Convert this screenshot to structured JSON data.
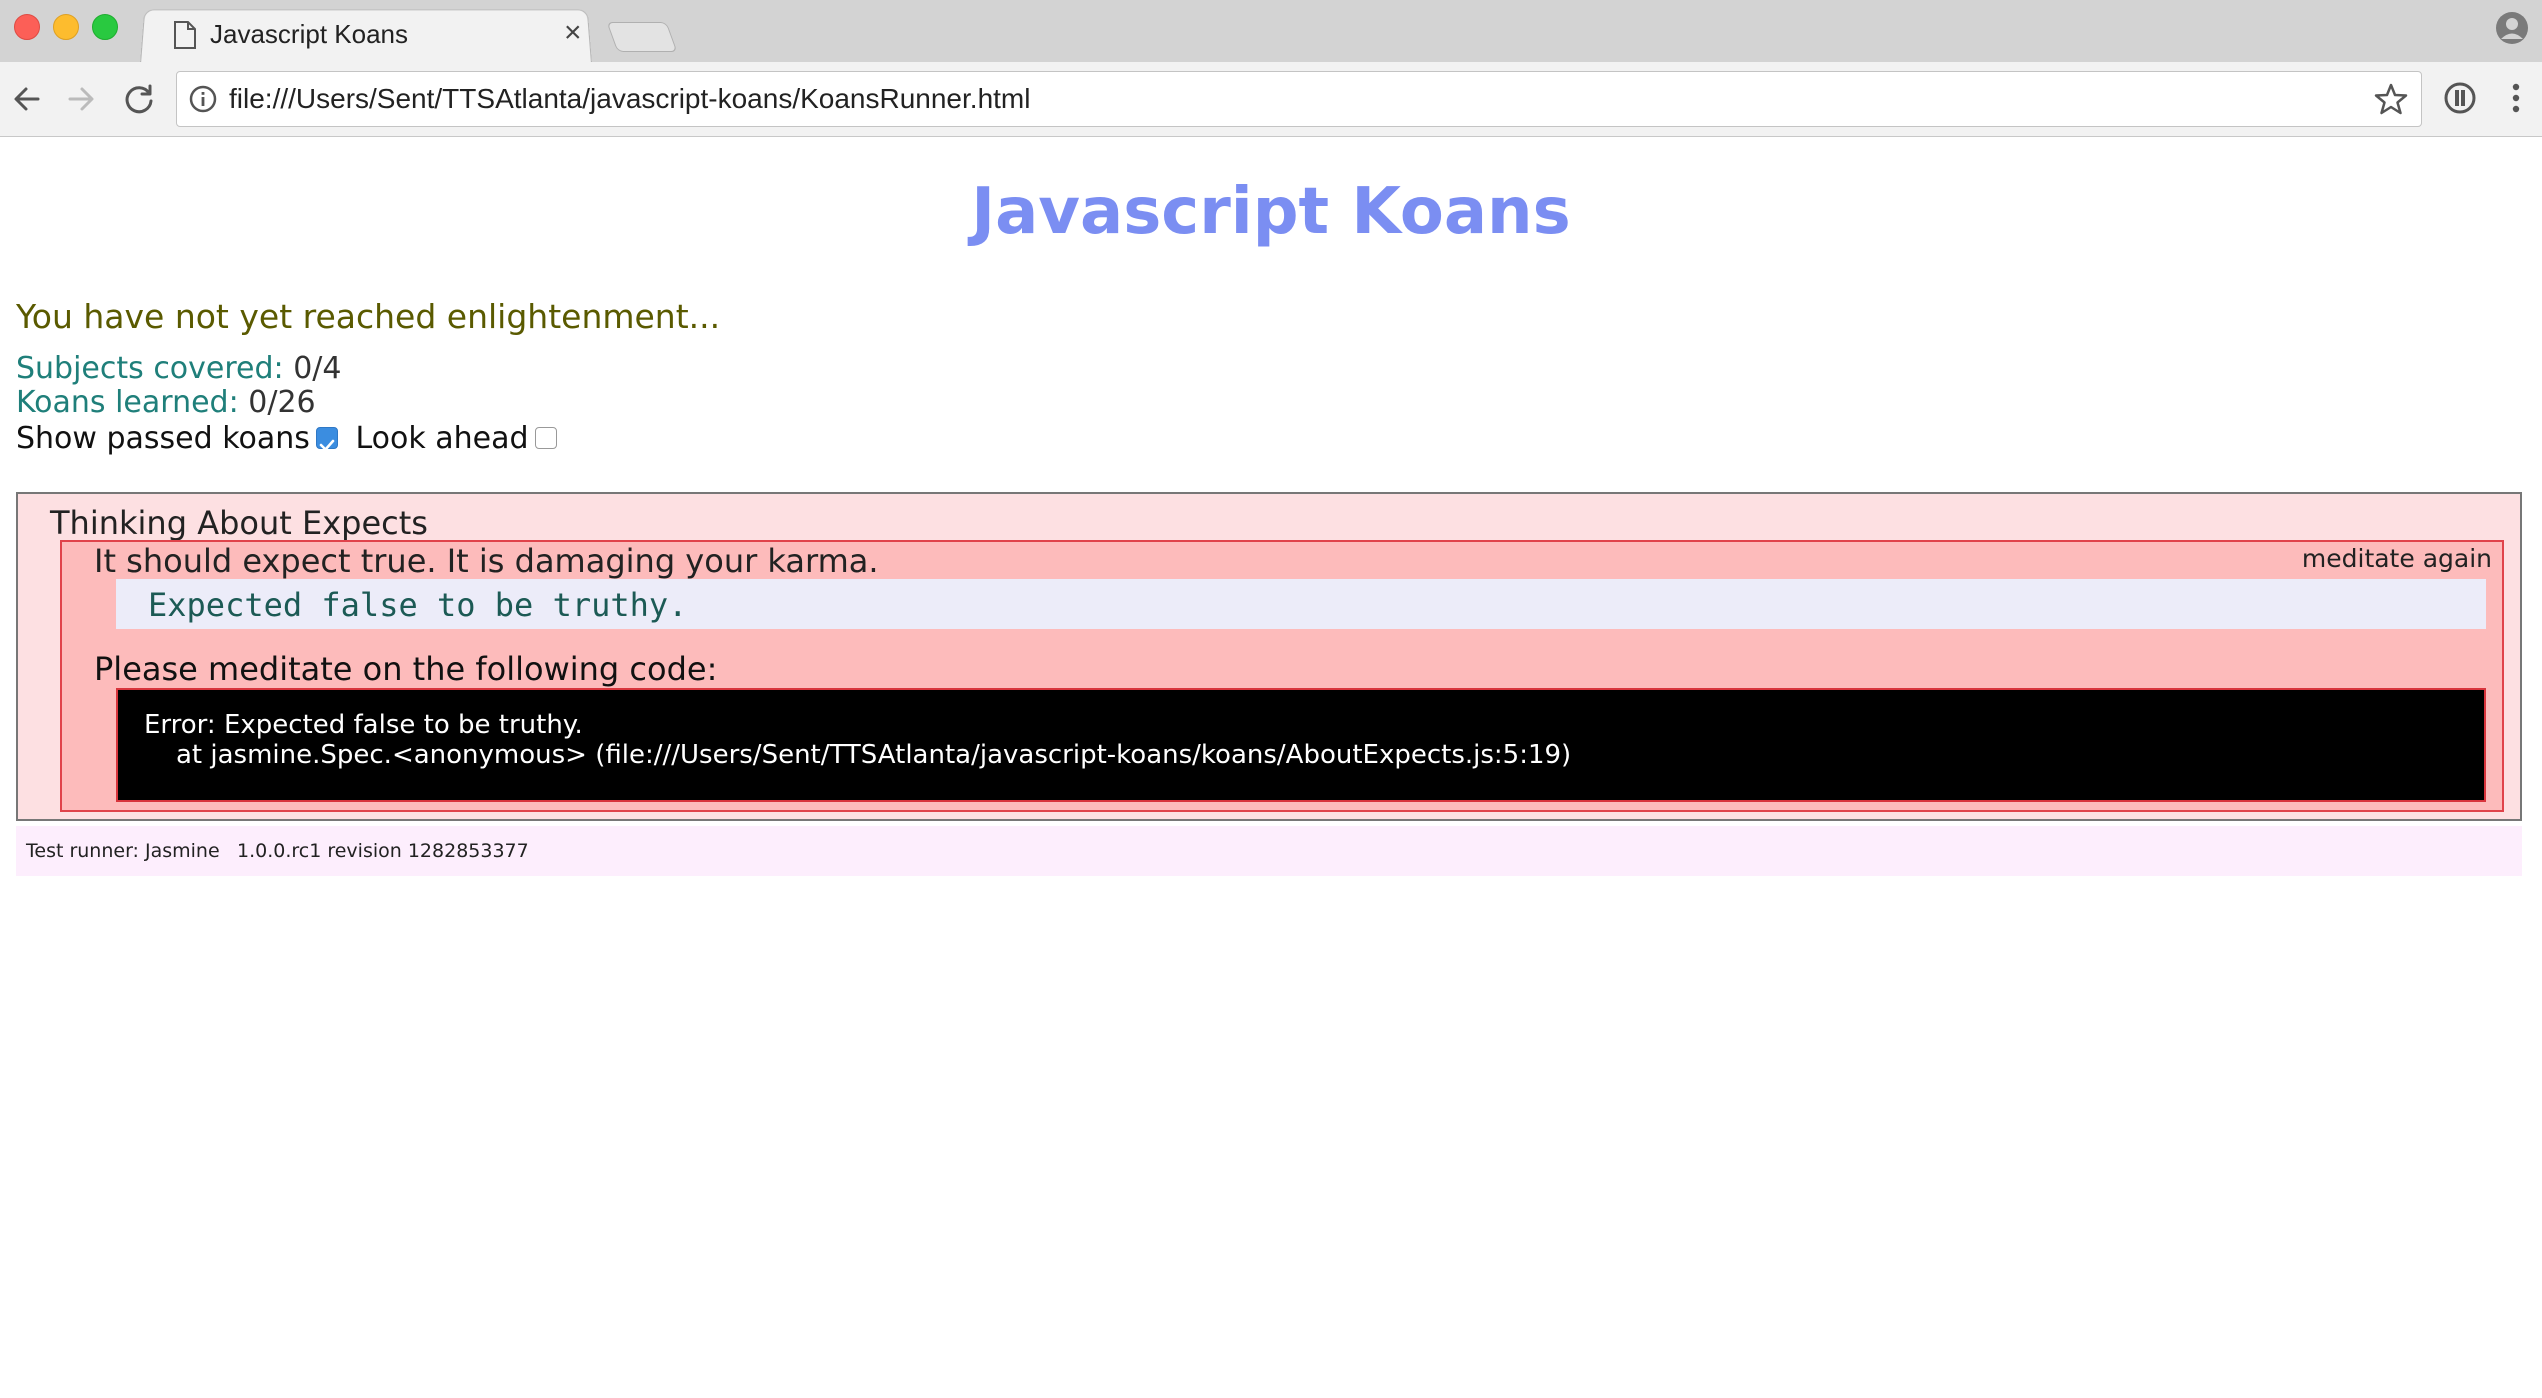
{
  "browser": {
    "tab": {
      "title": "Javascript Koans",
      "close_glyph": "×"
    },
    "address": {
      "url": "file:///Users/Sent/TTSAtlanta/javascript-koans/KoansRunner.html"
    },
    "icons": [
      "back-arrow-icon",
      "forward-arrow-icon",
      "reload-icon",
      "info-icon",
      "bookmark-star-icon",
      "extension-icon",
      "menu-dots-icon",
      "profile-icon",
      "document-icon"
    ]
  },
  "page": {
    "title": "Javascript Koans",
    "status": "You have not yet reached enlightenment...",
    "subjects": {
      "label": "Subjects covered:",
      "value": "0/4"
    },
    "koans": {
      "label": "Koans learned:",
      "value": "0/26"
    },
    "options": {
      "show_passed": {
        "label": "Show passed koans",
        "checked": true
      },
      "look_ahead": {
        "label": "Look ahead",
        "checked": false
      }
    },
    "suite": {
      "title": "Thinking About Expects",
      "spec": {
        "description": "It should expect true. It is damaging your karma.",
        "meditate_link": "meditate again",
        "message": "Expected false to be truthy.",
        "prompt": "Please meditate on the following code:",
        "code": {
          "line1": "Error: Expected false to be truthy.",
          "line2": "at jasmine.Spec.<anonymous> (file:///Users/Sent/TTSAtlanta/javascript-koans/koans/AboutExpects.js:5:19)"
        }
      }
    },
    "footer": {
      "runner": "Test runner: Jasmine",
      "version": "1.0.0.rc1 revision 1282853377"
    }
  },
  "colors": {
    "title": "#7b8ef2",
    "status": "#5a5a00",
    "label": "#1f7f7a",
    "suite_bg": "#fde0e2",
    "spec_bg": "#fdbbbb",
    "spec_border": "#e0434b",
    "code_bg": "#000000",
    "footer_bg": "#fdeefd"
  }
}
